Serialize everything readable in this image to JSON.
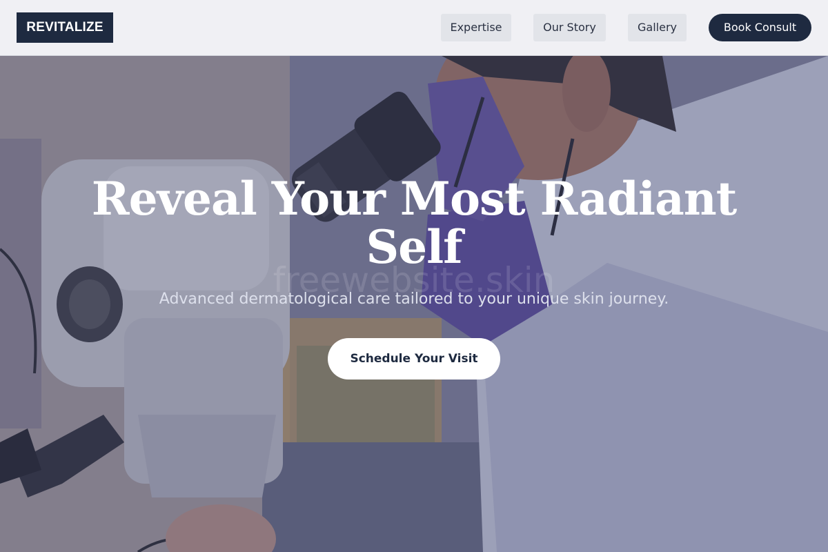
{
  "header": {
    "logo": "REVITALIZE",
    "nav": {
      "expertise": "Expertise",
      "our_story": "Our Story",
      "gallery": "Gallery",
      "book": "Book Consult"
    }
  },
  "hero": {
    "title_line1": "Reveal Your Most Radiant",
    "title_line2": "Self",
    "watermark": "freewebsite.skin",
    "subtitle": "Advanced dermatological care tailored to your unique skin journey.",
    "cta": "Schedule Your Visit",
    "image": "dermatologist-at-microscope-photo"
  },
  "colors": {
    "brand_navy": "#1e2a40",
    "header_bg": "#f0f0f4",
    "nav_button_bg": "#e2e4e9",
    "overlay_tint": "#40466e"
  }
}
